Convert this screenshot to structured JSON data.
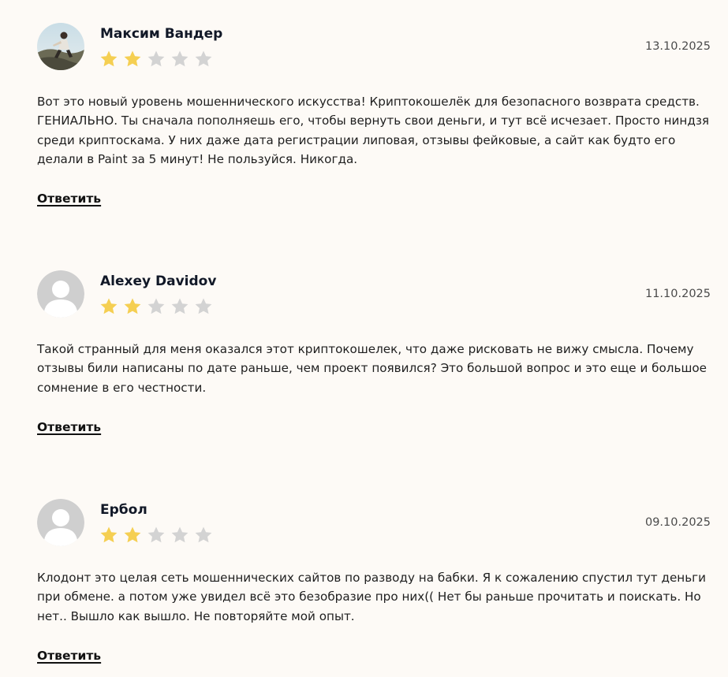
{
  "reviews": [
    {
      "author": "Максим Вандер",
      "rating": 2,
      "max_rating": 5,
      "date": "13.10.2025",
      "avatar": "user-photo",
      "text": "Вот это новый уровень мошеннического искусства! Криптокошелёк для безопасного возврата средств. ГЕНИАЛЬНО. Ты сначала пополняешь его, чтобы вернуть свои деньги, и тут всё исчезает. Просто ниндзя среди криптоскама. У них даже дата регистрации липовая, отзывы фейковые, а сайт как будто его делали в Paint за 5 минут! Не пользуйся. Никогда.",
      "reply_label": "Ответить"
    },
    {
      "author": "Alexey Davidov",
      "rating": 2,
      "max_rating": 5,
      "date": "11.10.2025",
      "avatar": "default-avatar",
      "text": "Такой странный для меня оказался этот криптокошелек, что даже рисковать не вижу смысла. Почему отзывы били написаны по дате раньше, чем проект появился? Это большой вопрос и это еще и большое сомнение в его честности.",
      "reply_label": "Ответить"
    },
    {
      "author": "Ербол",
      "rating": 2,
      "max_rating": 5,
      "date": "09.10.2025",
      "avatar": "default-avatar",
      "text": "Клодонт это целая сеть мошеннических сайтов по разводу на бабки. Я к сожалению спустил тут деньги при обмене. а потом уже увидел всё это безобразие про них(( Нет бы раньше прочитать и поискать. Но нет.. Вышло как вышло. Не повторяйте мой опыт.",
      "reply_label": "Ответить"
    }
  ],
  "colors": {
    "background": "#fdfaf6",
    "star_filled": "#f5cf52",
    "star_empty": "#d3d3d3",
    "avatar_default": "#cfcfcf"
  }
}
